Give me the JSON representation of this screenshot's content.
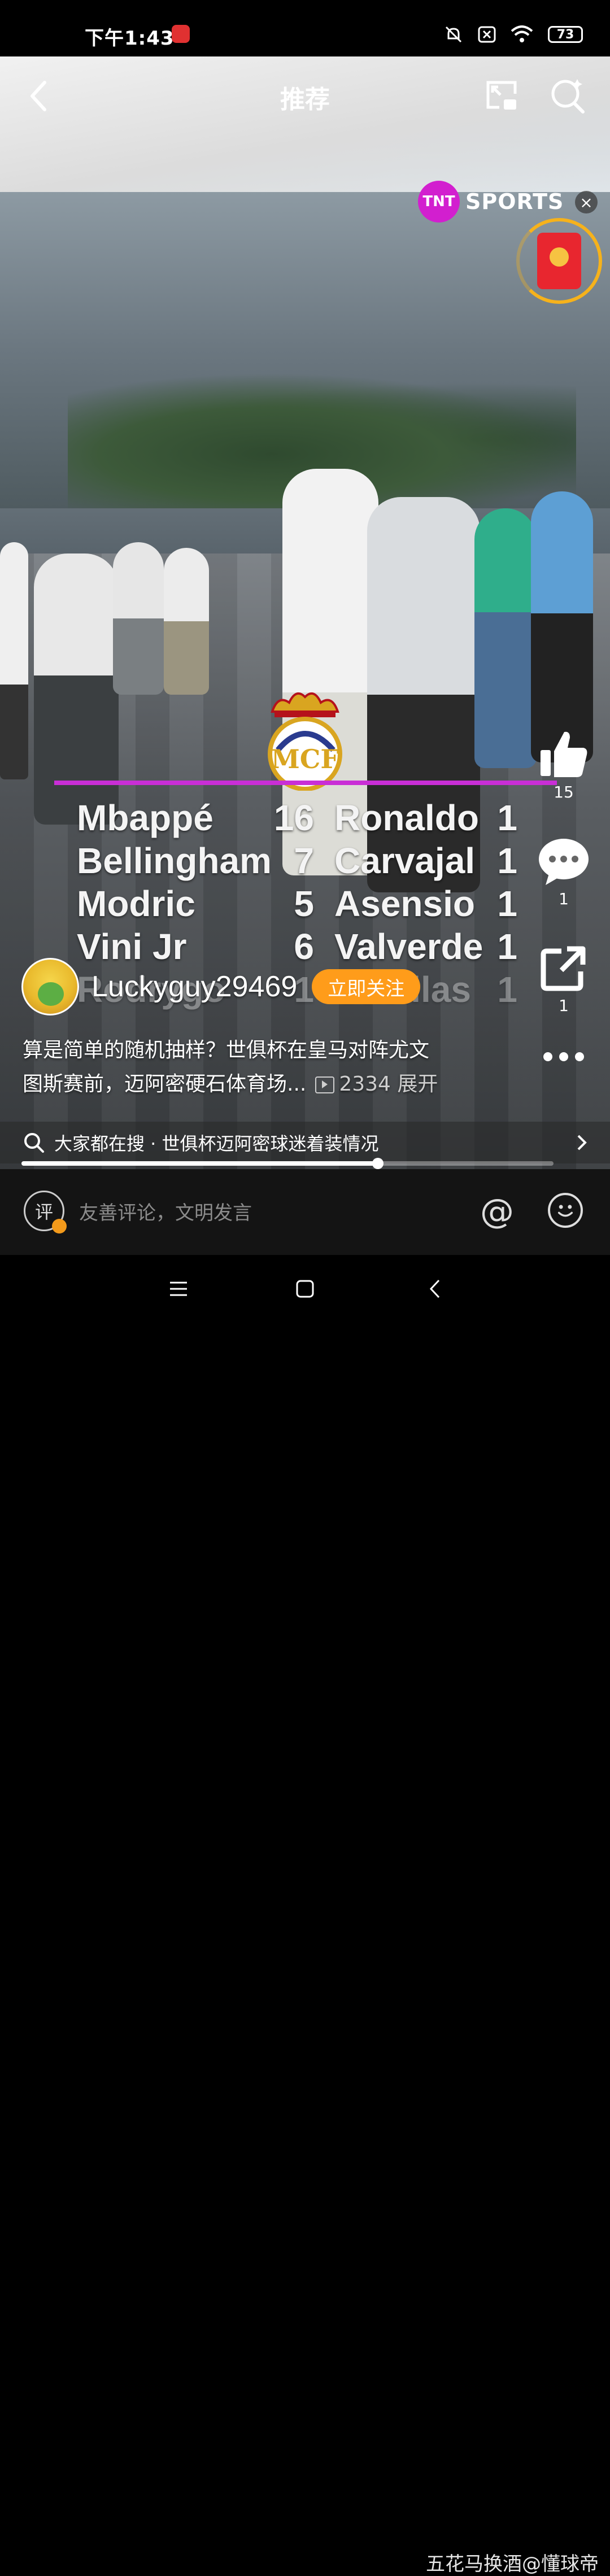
{
  "status_bar": {
    "time": "下午1:43",
    "battery": "73"
  },
  "top_nav": {
    "title": "推荐"
  },
  "overlay": {
    "tnt_badge": "TNT",
    "tnt_label": "SPORTS",
    "close_glyph": "×"
  },
  "score_table": {
    "rows": [
      {
        "name1": "Mbappé",
        "num1": "16",
        "name2": "Ronaldo",
        "num2": "1"
      },
      {
        "name1": "Bellingham",
        "num1": "7",
        "name2": "Carvajal",
        "num2": "1"
      },
      {
        "name1": "Modric",
        "num1": "5",
        "name2": "Asensio",
        "num2": "1"
      },
      {
        "name1": "Vini Jr",
        "num1": "6",
        "name2": "Valverde",
        "num2": "1"
      },
      {
        "name1": "Rodrygo",
        "num1": "1",
        "name2": "Casillas",
        "num2": "1"
      }
    ]
  },
  "actions": {
    "likes": "15",
    "comments": "1",
    "shares": "1"
  },
  "author": {
    "name": "Luckyguy29469",
    "follow_label": "立即关注"
  },
  "description": {
    "line1": "算是简单的随机抽样？世俱杯在皇马对阵尤文",
    "line2": "图斯赛前，迈阿密硬石体育场...",
    "views": "2334",
    "expand": "展开"
  },
  "search_strip": {
    "text": "大家都在搜 · 世俱杯迈阿密球迷着装情况"
  },
  "progress": {
    "fraction": 0.67
  },
  "comment_bar": {
    "avatar_char": "评",
    "placeholder": "友善评论，文明发言",
    "at": "@"
  },
  "watermark": "五花马换酒@懂球帝",
  "colors": {
    "accent_orange": "#ff9c1a",
    "tnt_magenta": "#d21fcf",
    "bar_magenta": "#c92ed6"
  }
}
